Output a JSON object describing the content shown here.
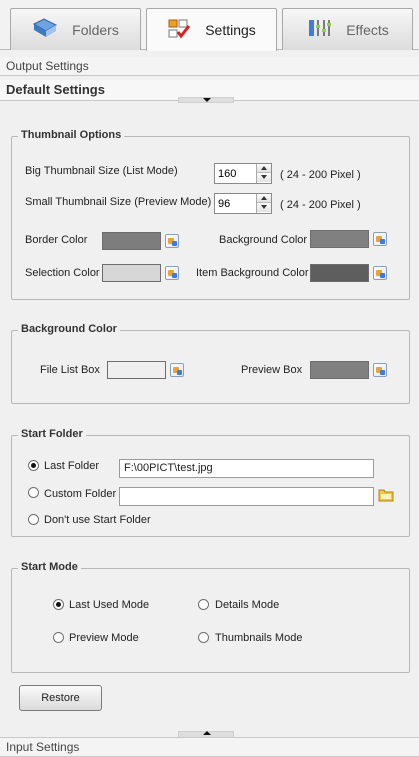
{
  "tabs": [
    {
      "label": "Folders",
      "icon": "folders-icon",
      "active": false
    },
    {
      "label": "Settings",
      "icon": "settings-icon",
      "active": true
    },
    {
      "label": "Effects",
      "icon": "effects-icon",
      "active": false
    }
  ],
  "sections": {
    "output": "Output Settings",
    "default": "Default Settings",
    "input": "Input Settings"
  },
  "thumbnail_options": {
    "title": "Thumbnail Options",
    "big_label": "Big Thumbnail Size (List Mode)",
    "big_value": "160",
    "big_range": "( 24 - 200 Pixel )",
    "small_label": "Small Thumbnail Size (Preview Mode)",
    "small_value": "96",
    "small_range": "( 24 - 200 Pixel )",
    "border_color_label": "Border Color",
    "border_color": "#7d7d7d",
    "background_color_label": "Background Color",
    "background_color": "#808080",
    "selection_color_label": "Selection Color",
    "selection_color": "#d7d7d7",
    "item_bg_color_label": "Item Background Color",
    "item_bg_color": "#5e5e5e"
  },
  "background_color": {
    "title": "Background Color",
    "file_list_label": "File List Box",
    "file_list_color": "#efefef",
    "preview_label": "Preview Box",
    "preview_color": "#808080"
  },
  "start_folder": {
    "title": "Start Folder",
    "last_folder_label": "Last Folder",
    "last_folder_value": "F:\\00PICT\\test.jpg",
    "custom_folder_label": "Custom Folder",
    "custom_folder_value": "",
    "dont_use_label": "Don't use Start Folder",
    "selected": "last"
  },
  "start_mode": {
    "title": "Start Mode",
    "last_used": "Last Used Mode",
    "details": "Details Mode",
    "preview": "Preview Mode",
    "thumbnails": "Thumbnails Mode",
    "selected": "last_used"
  },
  "restore_button": "Restore"
}
